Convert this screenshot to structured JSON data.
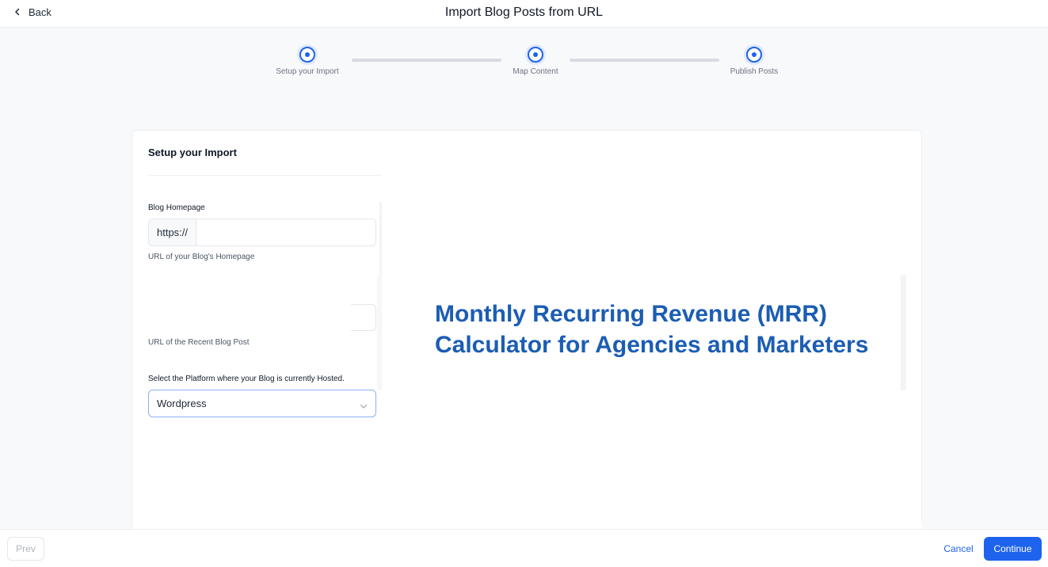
{
  "header": {
    "back_label": "Back",
    "title": "Import Blog Posts from URL",
    "back_icon": "chevron-left-icon"
  },
  "stepper": {
    "steps": [
      {
        "label": "Setup your Import",
        "state": "active"
      },
      {
        "label": "Map Content",
        "state": "active"
      },
      {
        "label": "Publish Posts",
        "state": "active"
      }
    ],
    "accent": "#1d63ed"
  },
  "form": {
    "section_title": "Setup your Import",
    "blog_homepage": {
      "label": "Blog Homepage",
      "prefix": "https://",
      "value": "",
      "help": "URL of your Blog's Homepage"
    },
    "recent_post": {
      "value": "",
      "help": "URL of the Recent Blog Post"
    },
    "platform": {
      "label": "Select the Platform where your Blog is currently Hosted.",
      "selected": "Wordpress",
      "icon": "chevron-down-icon"
    }
  },
  "preview": {
    "heading": "Monthly Recurring Revenue (MRR) Calculator for Agencies and Marketers",
    "color": "#1b5db3"
  },
  "footer": {
    "prev_label": "Prev",
    "cancel_label": "Cancel",
    "continue_label": "Continue",
    "primary_color": "#1d63ed"
  }
}
